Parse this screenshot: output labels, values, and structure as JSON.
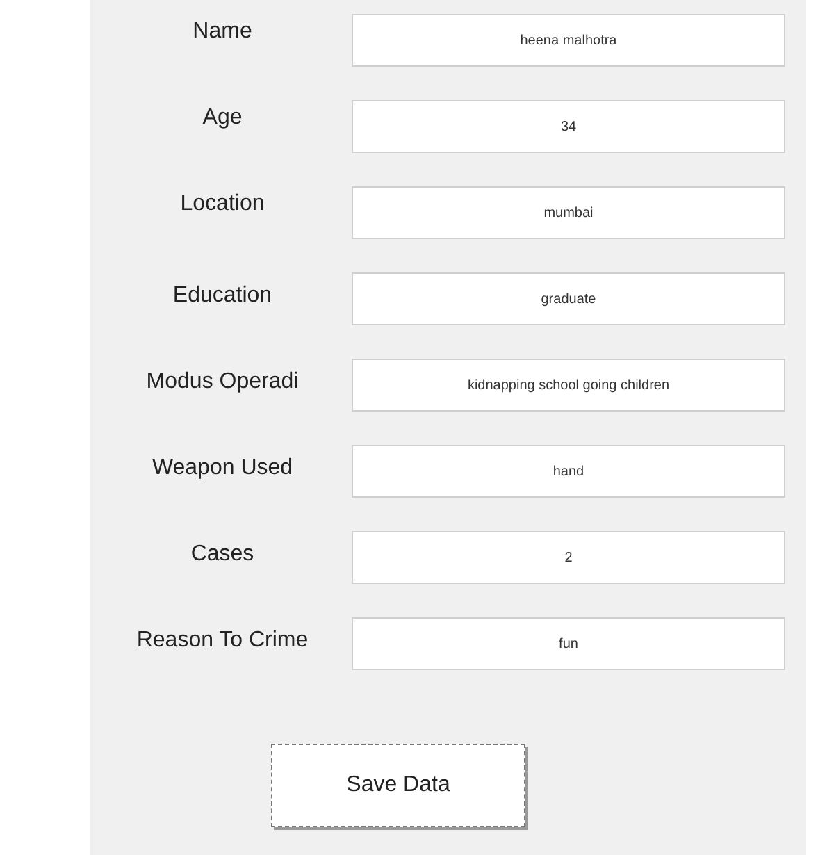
{
  "fields": [
    {
      "label": "Name",
      "value": "heena malhotra"
    },
    {
      "label": "Age",
      "value": "34"
    },
    {
      "label": "Location",
      "value": "mumbai"
    },
    {
      "label": "Education",
      "value": "graduate"
    },
    {
      "label": "Modus Operadi",
      "value": "kidnapping school going children"
    },
    {
      "label": "Weapon Used",
      "value": "hand"
    },
    {
      "label": "Cases",
      "value": "2"
    },
    {
      "label": "Reason To Crime",
      "value": "fun"
    }
  ],
  "buttons": [
    "Save Data"
  ]
}
